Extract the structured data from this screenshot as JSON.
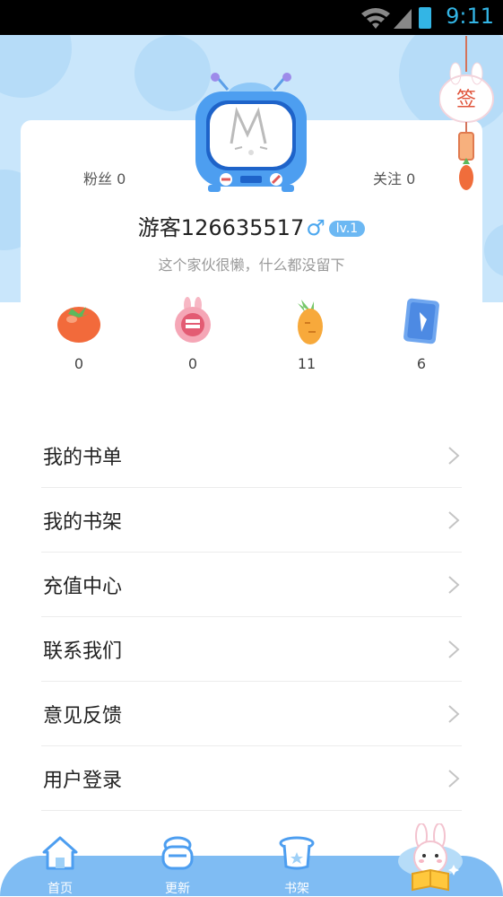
{
  "status_bar": {
    "time": "9:11"
  },
  "profile": {
    "fans_label": "粉丝 0",
    "follow_label": "关注 0",
    "username": "游客126635517",
    "gender_symbol": "♂",
    "level": "lv.1",
    "bio": "这个家伙很懒，什么都没留下"
  },
  "sign_button": {
    "label": "签"
  },
  "stats": [
    {
      "icon": "tomato-icon",
      "value": "0"
    },
    {
      "icon": "bunny-coin-icon",
      "value": "0"
    },
    {
      "icon": "carrot-icon",
      "value": "11"
    },
    {
      "icon": "carrot-card-icon",
      "value": "6"
    }
  ],
  "menu": {
    "items": [
      {
        "label": "我的书单"
      },
      {
        "label": "我的书架"
      },
      {
        "label": "充值中心"
      },
      {
        "label": "联系我们"
      },
      {
        "label": "意见反馈"
      },
      {
        "label": "用户登录"
      }
    ]
  },
  "tabbar": {
    "tabs": [
      {
        "label": "首页",
        "icon": "house-icon"
      },
      {
        "label": "更新",
        "icon": "bun-icon"
      },
      {
        "label": "书架",
        "icon": "bookshelf-icon"
      },
      {
        "label": "",
        "icon": "bunny-reading-icon"
      }
    ]
  },
  "colors": {
    "accent": "#4ba7ef",
    "header_bg": "#c9e6fb",
    "tabbar_bg": "#7fbcf3",
    "level_badge": "#6cb8f3"
  }
}
